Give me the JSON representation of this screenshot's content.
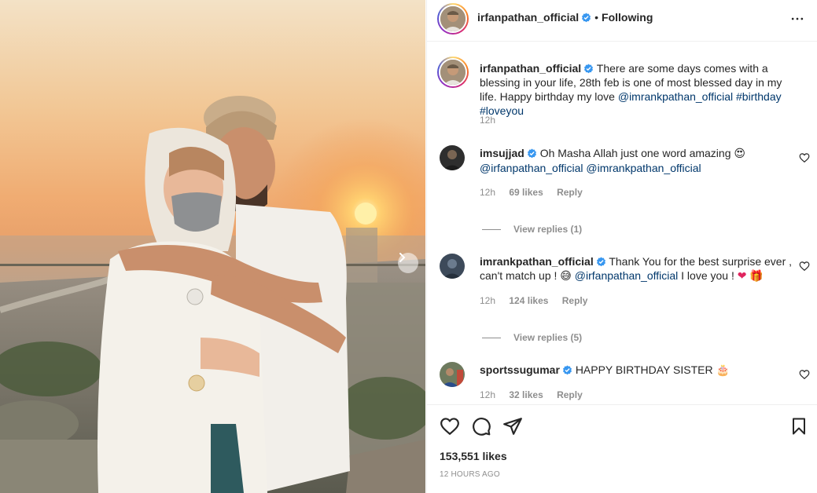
{
  "post": {
    "author": "irfanpathan_official",
    "follow_dot": "•",
    "follow_status": "Following",
    "caption": {
      "username": "irfanpathan_official",
      "text": "There are some days comes with a blessing in your life, 28th feb is one of most blessed day in my life. Happy birthday my love",
      "mention": "@imrankpathan_official",
      "tag1": "#birthday",
      "tag2": "#loveyou",
      "time": "12h"
    }
  },
  "comments": [
    {
      "username": "imsujjad",
      "text": "Oh Masha Allah just one word amazing",
      "emoji": "😍",
      "mention1": "@irfanpathan_official",
      "mention2": "@imrankpathan_official",
      "time": "12h",
      "likes": "69 likes",
      "reply": "Reply",
      "view_replies": "View replies (1)"
    },
    {
      "username": "imrankpathan_official",
      "text1": "Thank You for the best surprise ever , can't match up !",
      "emoji1": "😅",
      "mention": "@irfanpathan_official",
      "text2": "I love you !",
      "emoji2": "❤",
      "emoji3": "🎁",
      "time": "12h",
      "likes": "124 likes",
      "reply": "Reply",
      "view_replies": "View replies (5)"
    },
    {
      "username": "sportssugumar",
      "text": "HAPPY BIRTHDAY SISTER",
      "emoji": "🎂",
      "time": "12h",
      "likes": "32 likes",
      "reply": "Reply"
    }
  ],
  "footer": {
    "likes": "153,551 likes",
    "time_ago": "12 HOURS AGO"
  },
  "icons": {
    "heart": "heart-icon",
    "comment": "comment-icon",
    "share": "share-icon",
    "save": "bookmark-icon",
    "verified": "verified-badge-icon",
    "more": "more-options-icon",
    "next": "chevron-right-icon"
  },
  "colors": {
    "verified": "#3897f0",
    "link": "#00376b",
    "muted": "#8e8e8e",
    "text": "#262626"
  }
}
